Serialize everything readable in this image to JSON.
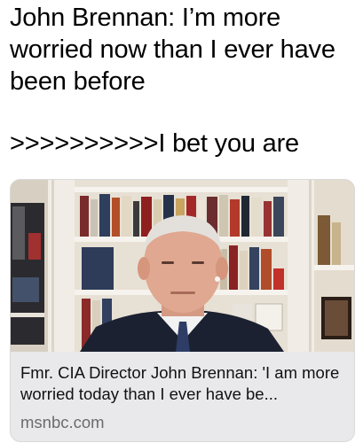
{
  "post": {
    "headline_lines": [
      "John Brennan: I’m more",
      "worried now than I ever have",
      "been before"
    ],
    "reply_text": ">>>>>>>>>>I bet you are"
  },
  "link_card": {
    "title": "Fmr. CIA Director John Brennan: 'I am more worried today than I ever have be...",
    "domain": "msnbc.com"
  },
  "colors": {
    "card_background": "#e9e9eb",
    "domain_text": "#6b6b6b",
    "suit": "#1b2130",
    "bookshelf": "#b7a48a"
  }
}
